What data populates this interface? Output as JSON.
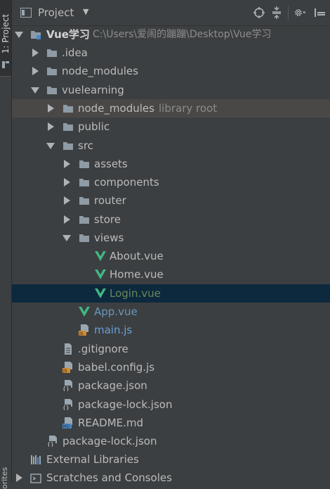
{
  "sidebar": {
    "tab_label": "1: Project",
    "bottom_label": "orites"
  },
  "header": {
    "title": "Project",
    "dropdown_glyph": "▼"
  },
  "tree": {
    "root_name": "Vue学习",
    "root_path": "C:\\Users\\爱闹的蹦蹦\\Desktop\\Vue学习",
    "items": [
      {
        "label": "Vue学习"
      },
      {
        "label": ".idea"
      },
      {
        "label": "node_modules"
      },
      {
        "label": "vuelearning"
      },
      {
        "label": "node_modules",
        "suffix": "library root"
      },
      {
        "label": "public"
      },
      {
        "label": "src"
      },
      {
        "label": "assets"
      },
      {
        "label": "components"
      },
      {
        "label": "router"
      },
      {
        "label": "store"
      },
      {
        "label": "views"
      },
      {
        "label": "About.vue"
      },
      {
        "label": "Home.vue"
      },
      {
        "label": "Login.vue"
      },
      {
        "label": "App.vue"
      },
      {
        "label": "main.js"
      },
      {
        "label": ".gitignore"
      },
      {
        "label": "babel.config.js"
      },
      {
        "label": "package.json"
      },
      {
        "label": "package-lock.json"
      },
      {
        "label": "README.md"
      },
      {
        "label": "package-lock.json"
      },
      {
        "label": "External Libraries"
      },
      {
        "label": "Scratches and Consoles"
      }
    ]
  },
  "colors": {
    "background": "#3c3f41",
    "selection": "#0d293e",
    "hover": "#4a4847",
    "vue_green": "#41b883",
    "folder": "#8e9aa4"
  },
  "icons": {
    "folder": "folder-icon",
    "vue": "vue-file-icon",
    "js": "js-file-icon",
    "json": "json-file-icon",
    "text": "text-file-icon",
    "md": "markdown-file-icon",
    "libraries": "libraries-icon"
  }
}
